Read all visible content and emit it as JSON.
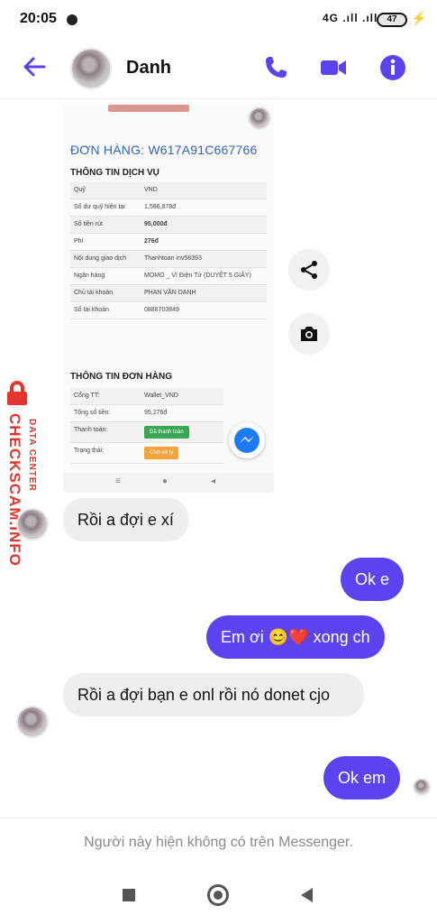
{
  "status_bar": {
    "time": "20:05",
    "signal_text": "4G .ıll .ıll",
    "battery": "47"
  },
  "header": {
    "contact_name": "Danh",
    "icons": [
      "back-arrow-icon",
      "phone-icon",
      "video-camera-icon",
      "info-icon"
    ],
    "accent_color": "#5b43f0"
  },
  "shared_image": {
    "order_title": "ĐƠN HÀNG: W617A91C667766",
    "service_section": "THÔNG TIN DỊCH VỤ",
    "service_rows": [
      {
        "key": "Quỹ",
        "value": "VND"
      },
      {
        "key": "Số dư quỹ hiện tại",
        "value": "1,586,878đ"
      },
      {
        "key": "Số tiền rút",
        "value": "95,000đ"
      },
      {
        "key": "Phí",
        "value": "276đ"
      },
      {
        "key": "Nội dung giao dịch",
        "value": "Thanhtoan inv58393"
      },
      {
        "key": "Ngân hàng",
        "value": "MOMO _ Ví Điện Tử (DUYỆT 5 GIÂY)"
      },
      {
        "key": "Chủ tài khoản",
        "value": "PHAN VĂN DANH"
      },
      {
        "key": "Số tài khoản",
        "value": "0888703849"
      }
    ],
    "order_section": "THÔNG TIN ĐƠN HÀNG",
    "order_rows": [
      {
        "key": "Cổng TT:",
        "value": "Wallet_VND"
      },
      {
        "key": "Tổng số tiền:",
        "value": "95,276đ"
      },
      {
        "key": "Thanh toán:",
        "badge": "Đã thanh toán"
      },
      {
        "key": "Trạng thái:",
        "badge": "Chờ xử lý"
      }
    ]
  },
  "watermark": {
    "line1": "DATA CENTER",
    "line2": "CHECKSCAM.INFO"
  },
  "messages": [
    {
      "direction": "incoming",
      "text": "Rồi a đợi e xí"
    },
    {
      "direction": "outgoing",
      "text": "Ok e"
    },
    {
      "direction": "outgoing",
      "text": "Em ơi 😊❤️ xong ch"
    },
    {
      "direction": "incoming",
      "text": "Rồi a đợi bạn e onl rồi nó donet cjo"
    },
    {
      "direction": "outgoing",
      "text": "Ok em"
    }
  ],
  "footer": {
    "notice": "Người này hiện không có trên Messenger."
  }
}
